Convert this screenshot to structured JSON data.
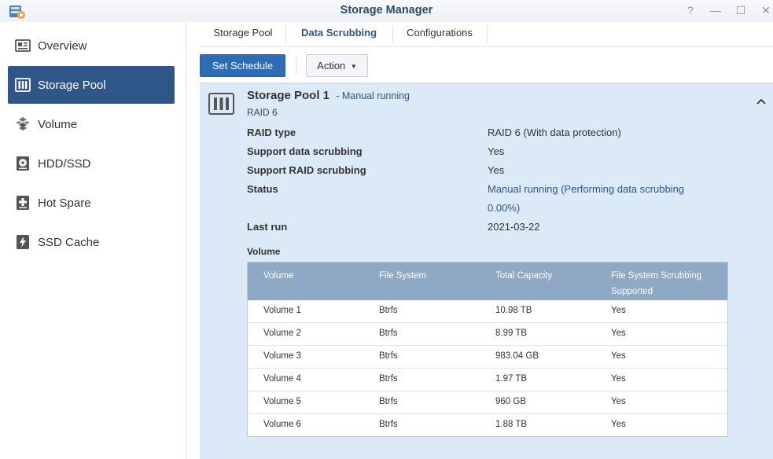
{
  "window": {
    "title": "Storage Manager",
    "controls": [
      "?",
      "—",
      "☐",
      "✕"
    ]
  },
  "sidebar": {
    "items": [
      {
        "label": "Overview",
        "icon": "overview-icon"
      },
      {
        "label": "Storage Pool",
        "icon": "storage-pool-icon",
        "active": true
      },
      {
        "label": "Volume",
        "icon": "volume-icon"
      },
      {
        "label": "HDD/SSD",
        "icon": "hdd-icon"
      },
      {
        "label": "Hot Spare",
        "icon": "hot-spare-icon"
      },
      {
        "label": "SSD Cache",
        "icon": "ssd-cache-icon"
      }
    ]
  },
  "tabs": [
    {
      "label": "Storage Pool"
    },
    {
      "label": "Data Scrubbing",
      "active": true
    },
    {
      "label": "Configurations"
    }
  ],
  "toolbar": {
    "set_schedule_label": "Set Schedule",
    "action_label": "Action"
  },
  "pool": {
    "name": "Storage Pool 1",
    "state": "- Manual running",
    "raid_sub": "RAID 6",
    "details": [
      {
        "label": "RAID type",
        "value": "RAID 6 (With data protection)"
      },
      {
        "label": "Support data scrubbing",
        "value": "Yes"
      },
      {
        "label": "Support RAID scrubbing",
        "value": "Yes"
      },
      {
        "label": "Status",
        "value": "Manual running (Performing data scrubbing",
        "value2": "0.00%)"
      },
      {
        "label": "Last run",
        "value": "2021-03-22"
      }
    ],
    "volume_heading": "Volume"
  },
  "volume_table": {
    "columns": [
      "Volume",
      "File System",
      "Total Capacity",
      "File System Scrubbing",
      "Supported"
    ],
    "rows": [
      {
        "volume": "Volume 1",
        "fs": "Btrfs",
        "capacity": "10.98 TB",
        "supported": "Yes"
      },
      {
        "volume": "Volume 2",
        "fs": "Btrfs",
        "capacity": "8.99 TB",
        "supported": "Yes"
      },
      {
        "volume": "Volume 3",
        "fs": "Btrfs",
        "capacity": "983.04 GB",
        "supported": "Yes"
      },
      {
        "volume": "Volume 4",
        "fs": "Btrfs",
        "capacity": "1.97 TB",
        "supported": "Yes"
      },
      {
        "volume": "Volume 5",
        "fs": "Btrfs",
        "capacity": "960 GB",
        "supported": "Yes"
      },
      {
        "volume": "Volume 6",
        "fs": "Btrfs",
        "capacity": "1.88 TB",
        "supported": "Yes"
      }
    ]
  },
  "colors": {
    "accent": "#2e5689",
    "primary_button": "#2e6cb5",
    "panel_bg": "#dce9f7",
    "table_header": "#8fa9c4"
  }
}
